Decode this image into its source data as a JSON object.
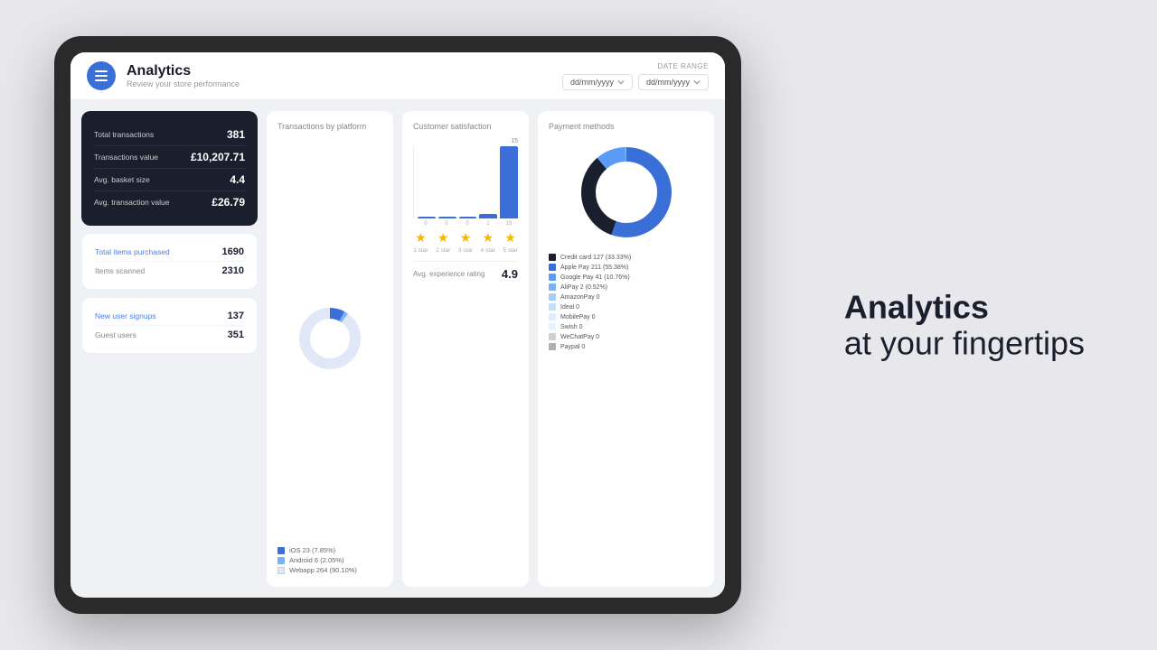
{
  "header": {
    "title": "Analytics",
    "subtitle": "Review your store performance",
    "date_range_label": "DATE RANGE",
    "date_from_placeholder": "dd/mm/yyyy",
    "date_to_placeholder": "dd/mm/yyyy"
  },
  "stats_dark": {
    "rows": [
      {
        "label": "Total transactions",
        "value": "381"
      },
      {
        "label": "Transactions value",
        "value": "£10,207.71"
      },
      {
        "label": "Avg. basket size",
        "value": "4.4"
      },
      {
        "label": "Avg. transaction value",
        "value": "£26.79"
      }
    ]
  },
  "stats_items": {
    "rows": [
      {
        "label": "Total items purchased",
        "value": "1690",
        "blue": true
      },
      {
        "label": "Items scanned",
        "value": "2310",
        "blue": false
      }
    ]
  },
  "stats_users": {
    "rows": [
      {
        "label": "New user signups",
        "value": "137",
        "blue": true
      },
      {
        "label": "Guest users",
        "value": "351",
        "blue": false
      }
    ]
  },
  "transactions_by_platform": {
    "title": "Transactions by platform",
    "legend": [
      {
        "label": "iOS 23 (7.85%)",
        "color": "#3a6fd8"
      },
      {
        "label": "Android 6 (2.05%)",
        "color": "#7ab3f5"
      },
      {
        "label": "Webapp 264 (90.10%)",
        "color": "#e0e8f8"
      }
    ],
    "donut": {
      "segments": [
        {
          "pct": 7.85,
          "color": "#3a6fd8"
        },
        {
          "pct": 2.05,
          "color": "#7ab3f5"
        },
        {
          "pct": 90.1,
          "color": "#e0e8f8"
        }
      ]
    }
  },
  "customer_satisfaction": {
    "title": "Customer satisfaction",
    "top_value": "15",
    "bars": [
      {
        "height": 2,
        "color": "#3a6fd8",
        "label": "1 star"
      },
      {
        "height": 2,
        "color": "#3a6fd8",
        "label": "2 star"
      },
      {
        "height": 2,
        "color": "#3a6fd8",
        "label": "3 star"
      },
      {
        "height": 5,
        "color": "#3a6fd8",
        "label": "4 star"
      },
      {
        "height": 80,
        "color": "#3a6fd8",
        "label": "5 star"
      }
    ],
    "stars": [
      "★",
      "★",
      "★",
      "★",
      "★"
    ],
    "avg_label": "Avg. experience rating",
    "avg_value": "4.9"
  },
  "payment_methods": {
    "title": "Payment methods",
    "legend": [
      {
        "label": "Credit card 127 (33.33%)",
        "color": "#1a1f2e"
      },
      {
        "label": "Apple Pay 211 (55.38%)",
        "color": "#3a6fd8"
      },
      {
        "label": "Google Pay 41 (10.76%)",
        "color": "#5b9bf8"
      },
      {
        "label": "AliPay 2 (0.52%)",
        "color": "#7ab3f5"
      },
      {
        "label": "AmazonPay 0",
        "color": "#a8cef8"
      },
      {
        "label": "Ideal 0",
        "color": "#c5def8"
      },
      {
        "label": "MobilePay 0",
        "color": "#dceeff"
      },
      {
        "label": "Swish 0",
        "color": "#e8f3ff"
      },
      {
        "label": "WeChatPay 0",
        "color": "#d0d0d0"
      },
      {
        "label": "Paypal 0",
        "color": "#b0b0b0"
      }
    ],
    "donut": {
      "segments": [
        {
          "pct": 33.33,
          "color": "#1a1f2e"
        },
        {
          "pct": 55.38,
          "color": "#3a6fd8"
        },
        {
          "pct": 10.76,
          "color": "#5b9bf8"
        },
        {
          "pct": 0.52,
          "color": "#7ab3f5"
        }
      ]
    }
  },
  "tagline": {
    "line1": "Analytics",
    "line2": "at your fingertips"
  }
}
